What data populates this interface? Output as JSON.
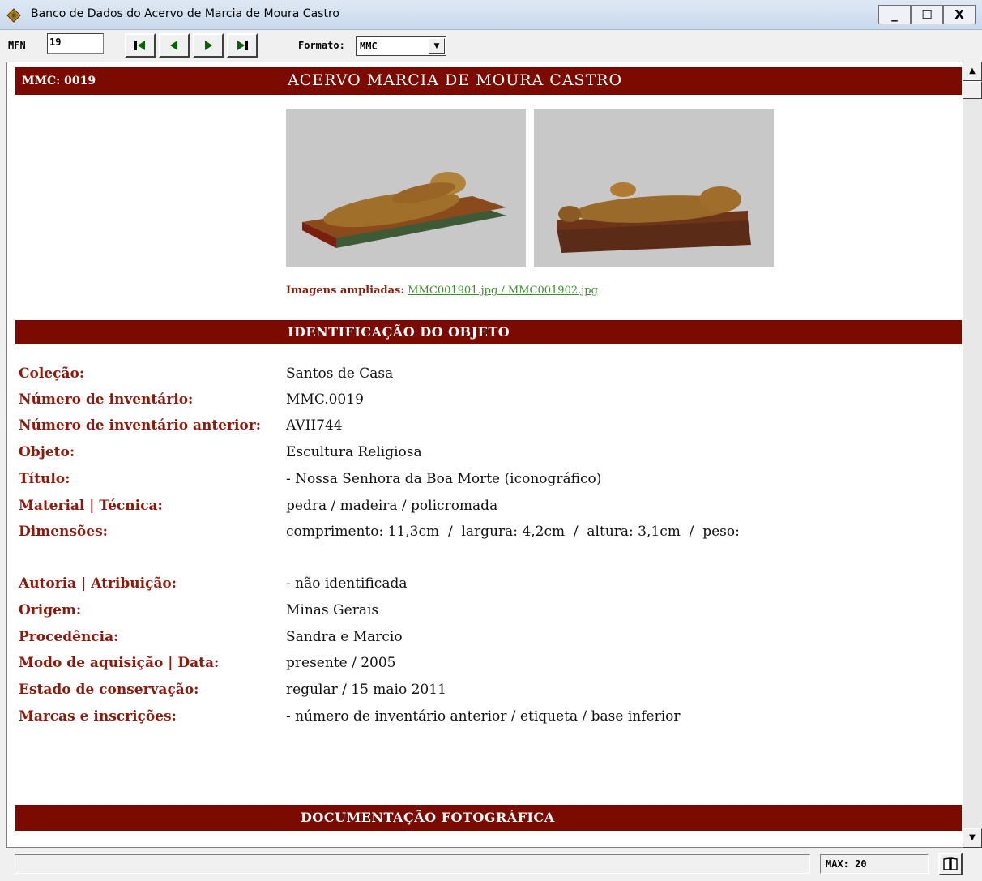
{
  "window": {
    "title": "Banco de Dados do Acervo de Marcia de Moura Castro",
    "minimize": "_",
    "maximize": "☐",
    "close": "X"
  },
  "toolbar": {
    "mfn_label": "MFN",
    "mfn_value": "19",
    "nav": [
      "first-record-icon",
      "previous-record-icon",
      "next-record-icon",
      "last-record-icon"
    ],
    "formato_label": "Formato:",
    "formato_value": "MMC"
  },
  "header": {
    "code": "MMC: 0019",
    "title": "ACERVO MARCIA DE MOURA CASTRO"
  },
  "images": {
    "caption_label": "Imagens ampliadas:",
    "links": "MMC001901.jpg / MMC001902.jpg"
  },
  "identificacao": {
    "title": "IDENTIFICAÇÃO DO OBJETO",
    "fields": [
      {
        "label": "Coleção:",
        "value": "Santos de Casa"
      },
      {
        "label": "Número de inventário:",
        "value": "MMC.0019"
      },
      {
        "label": "Número de inventário anterior:",
        "value": "AVII744"
      },
      {
        "label": "Objeto:",
        "value": "Escultura Religiosa"
      },
      {
        "label": "Título:",
        "value": "- Nossa Senhora da Boa Morte (iconográfico)"
      },
      {
        "label": "Material | Técnica:",
        "value": "pedra / madeira / policromada"
      },
      {
        "label": "Dimensões:",
        "value": "comprimento: 11,3cm  /  largura: 4,2cm  /  altura: 3,1cm  /  peso:"
      },
      {
        "label": "Autoria | Atribuição:",
        "value": "- não identificada"
      },
      {
        "label": "Origem:",
        "value": "Minas Gerais"
      },
      {
        "label": "Procedência:",
        "value": "Sandra e Marcio"
      },
      {
        "label": "Modo de aquisição | Data:",
        "value": "presente / 2005"
      },
      {
        "label": "Estado de conservação:",
        "value": "regular / 15 maio 2011"
      },
      {
        "label": "Marcas e inscrições:",
        "value": "- número de inventário anterior / etiqueta / base inferior"
      }
    ]
  },
  "documentacao": {
    "title": "DOCUMENTAÇÃO FOTOGRÁFICA"
  },
  "statusbar": {
    "status_text": "",
    "max_text": "MAX: 20"
  },
  "colors": {
    "banner": "#7b0b00",
    "label": "#8b1a0c",
    "link": "#3a8f2a"
  }
}
